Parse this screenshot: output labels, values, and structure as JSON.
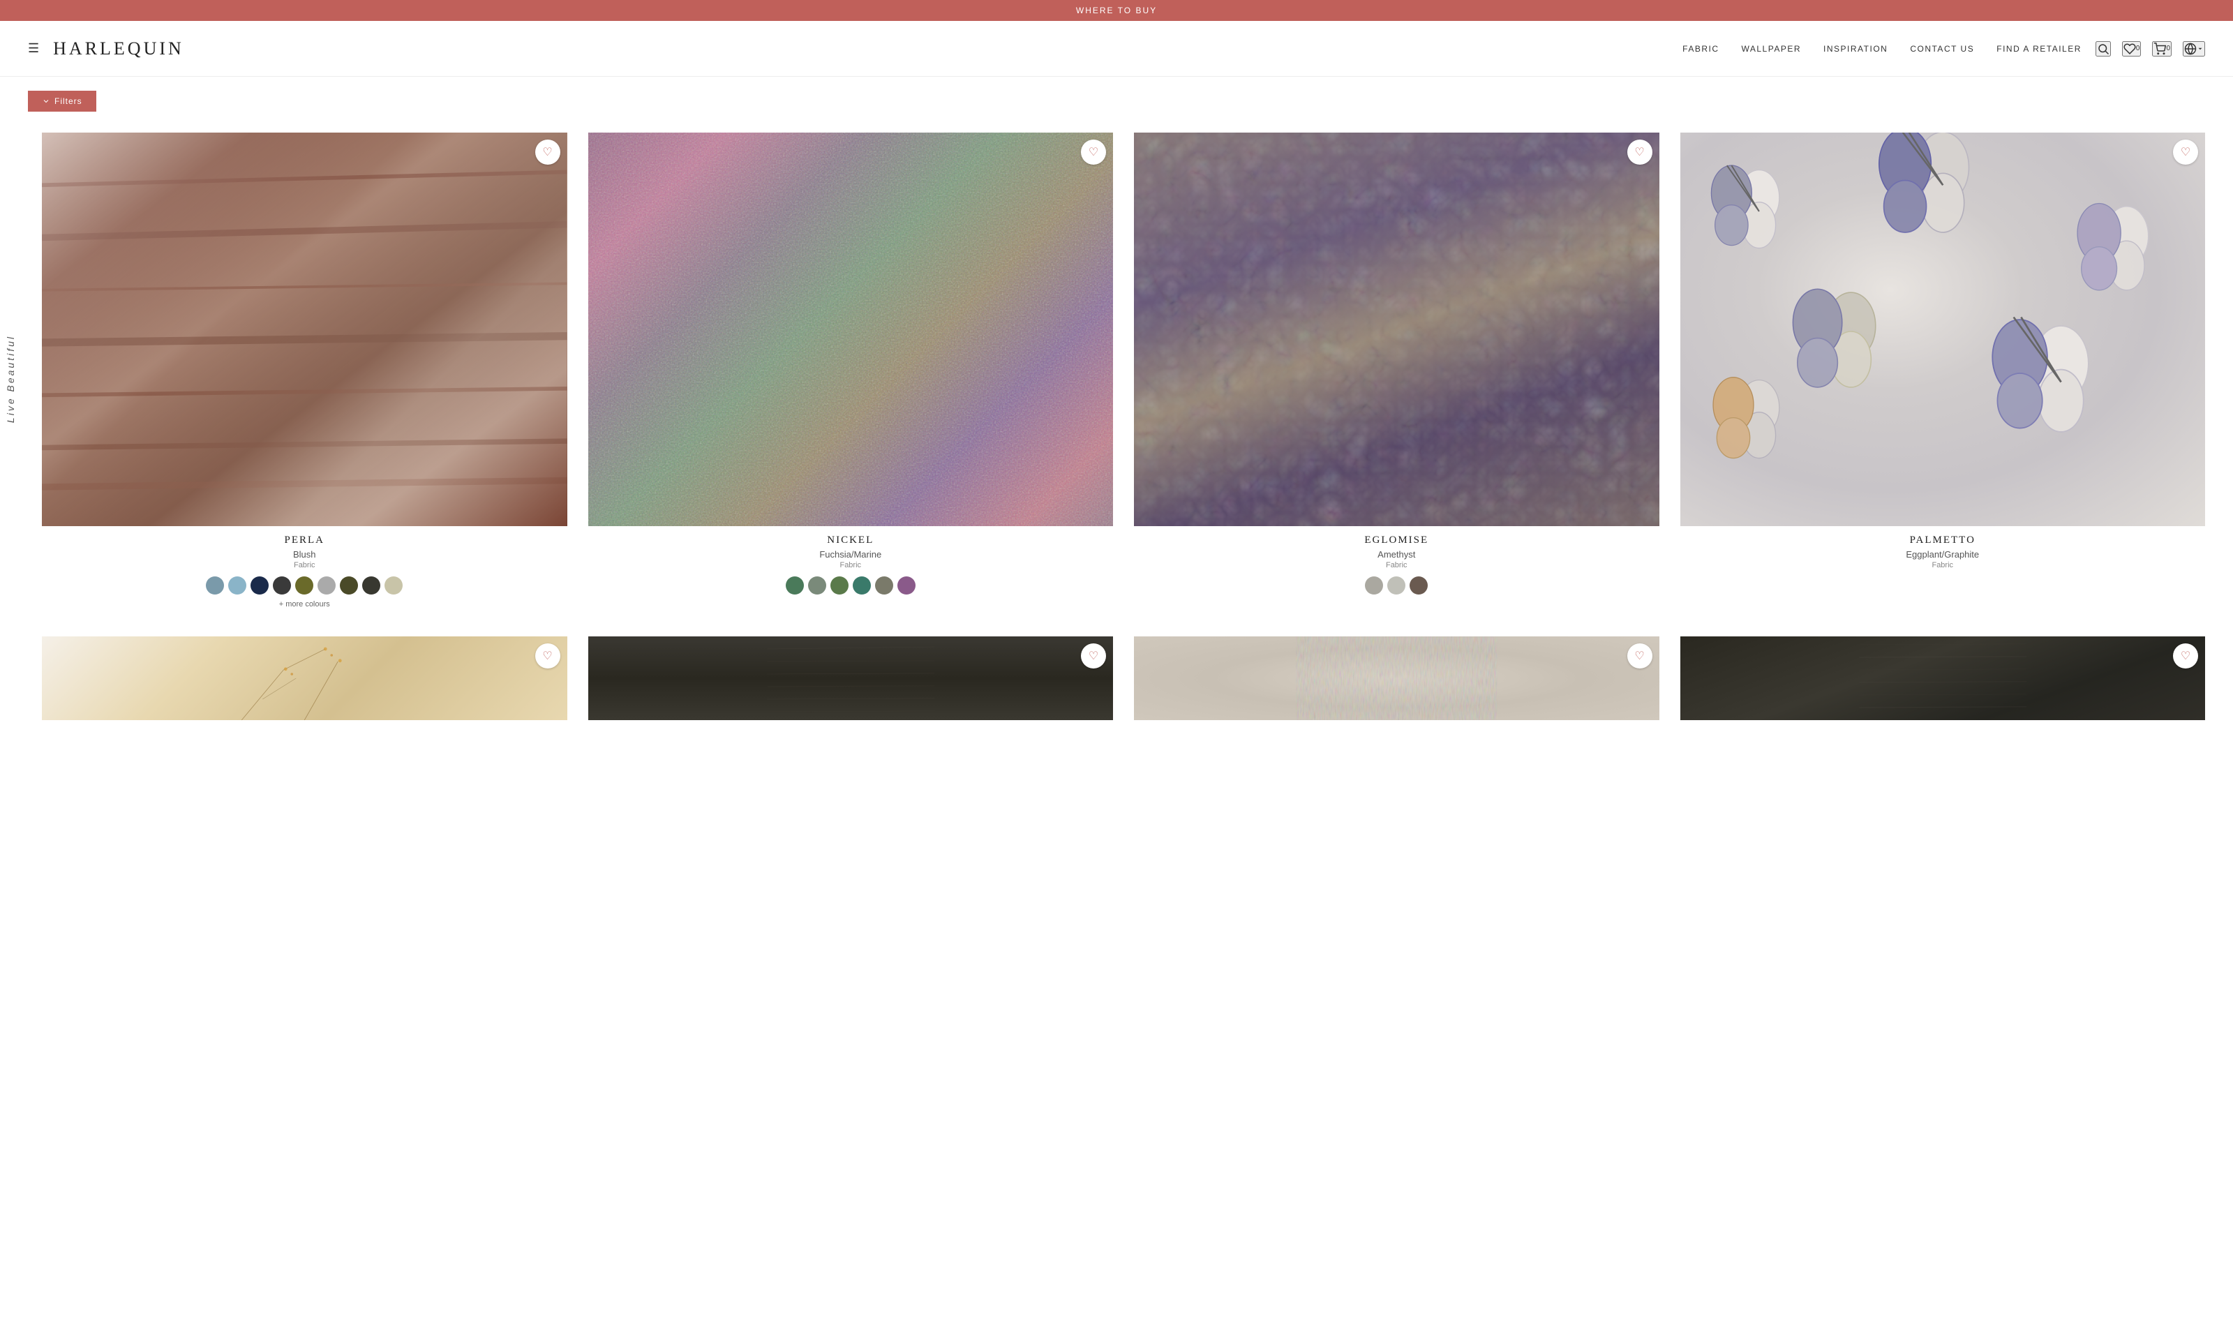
{
  "banner": {
    "text": "WHERE TO BUY"
  },
  "header": {
    "logo": "HARLEQUIN",
    "nav_items": [
      {
        "id": "fabric",
        "label": "FABRIC"
      },
      {
        "id": "wallpaper",
        "label": "WALLPAPER"
      },
      {
        "id": "inspiration",
        "label": "INSPIRATION"
      },
      {
        "id": "contact",
        "label": "CONTACT US"
      },
      {
        "id": "find-retailer",
        "label": "FIND A RETAILER"
      }
    ],
    "wishlist_count": "0",
    "cart_count": "0"
  },
  "filters": {
    "label": "Filters"
  },
  "vertical_label": "Live Beautiful",
  "products": [
    {
      "id": "perla",
      "name": "PERLA",
      "variant": "Blush",
      "type": "Fabric",
      "fabric_class": "fabric-perla",
      "swatches": [
        "#7a9aaa",
        "#8ab4c8",
        "#1a2a4a",
        "#3a3a3a",
        "#6a6a2a",
        "#aaaaaa",
        "#4a4a28",
        "#383830",
        "#c8c4a8"
      ],
      "more_colors": true,
      "more_colors_label": "+ more colours"
    },
    {
      "id": "nickel",
      "name": "NICKEL",
      "variant": "Fuchsia/Marine",
      "type": "Fabric",
      "fabric_class": "fabric-nickel",
      "swatches": [
        "#4a7a5a",
        "#7a8a7a",
        "#5a7a4a",
        "#3a7a6a",
        "#7a7a6a",
        "#8a5a8a"
      ],
      "more_colors": false
    },
    {
      "id": "eglomise",
      "name": "EGLOMISE",
      "variant": "Amethyst",
      "type": "Fabric",
      "fabric_class": "fabric-eglomise",
      "swatches": [
        "#aaa8a0",
        "#c0c0b8",
        "#6a5a50"
      ],
      "more_colors": false
    },
    {
      "id": "palmetto",
      "name": "PALMETTO",
      "variant": "Eggplant/Graphite",
      "type": "Fabric",
      "fabric_class": "fabric-palmetto",
      "swatches": [],
      "more_colors": false
    },
    {
      "id": "bottom1",
      "name": "",
      "variant": "",
      "type": "",
      "fabric_class": "fabric-bottom1",
      "swatches": [],
      "more_colors": false,
      "partial": true
    },
    {
      "id": "bottom2",
      "name": "",
      "variant": "",
      "type": "",
      "fabric_class": "fabric-bottom2",
      "swatches": [],
      "more_colors": false,
      "partial": true
    },
    {
      "id": "bottom3",
      "name": "",
      "variant": "",
      "type": "",
      "fabric_class": "fabric-bottom3",
      "swatches": [],
      "more_colors": false,
      "partial": true
    },
    {
      "id": "bottom4",
      "name": "",
      "variant": "",
      "type": "",
      "fabric_class": "fabric-bottom4",
      "swatches": [],
      "more_colors": false,
      "partial": true
    }
  ],
  "colors": {
    "brand_red": "#c0605a",
    "brand_dark": "#222222"
  }
}
